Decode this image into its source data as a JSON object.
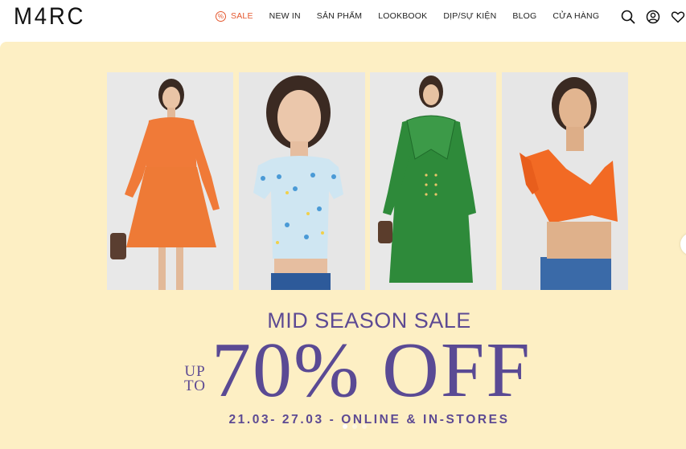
{
  "header": {
    "logo": "M4RC",
    "nav": [
      {
        "label": "SALE"
      },
      {
        "label": "NEW IN"
      },
      {
        "label": "SẢN PHẨM"
      },
      {
        "label": "LOOKBOOK"
      },
      {
        "label": "DỊP/SỰ KIỆN"
      },
      {
        "label": "BLOG"
      },
      {
        "label": "CỬA HÀNG"
      }
    ],
    "sale_badge": "%",
    "icons": [
      "search-icon",
      "user-icon",
      "heart-icon"
    ]
  },
  "banner": {
    "headline": "MID SEASON SALE",
    "upto_line1": "UP",
    "upto_line2": "TO",
    "discount": "70% OFF",
    "dates": "21.03- 27.03 - ONLINE & IN-STORES",
    "slides": 3,
    "active_slide": 1
  },
  "colors": {
    "banner_bg": "#fdefc4",
    "accent_purple": "#5d4a93",
    "sale_red": "#e4572e"
  }
}
